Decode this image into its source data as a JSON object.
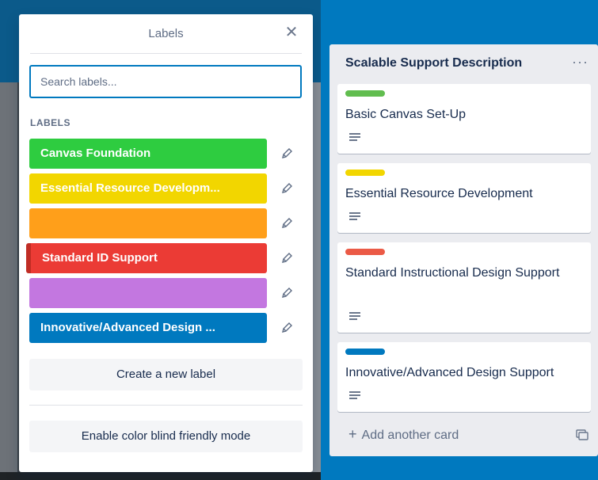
{
  "popover": {
    "title": "Labels",
    "close_icon": "close-icon",
    "search_placeholder": "Search labels...",
    "section_label": "LABELS",
    "labels": [
      {
        "name": "Canvas Foundation",
        "color": "#2ecc40"
      },
      {
        "name": "Essential Resource Developm...",
        "color": "#f2d600"
      },
      {
        "name": "",
        "color": "#ff9f1a"
      },
      {
        "name": "Standard ID Support",
        "color": "#eb3b35"
      },
      {
        "name": "",
        "color": "#c377e0"
      },
      {
        "name": "Innovative/Advanced Design ...",
        "color": "#0079bf"
      }
    ],
    "edit_icon": "pencil-icon",
    "create_label": "Create a new label",
    "colorblind_label": "Enable color blind friendly mode"
  },
  "list": {
    "title": "Scalable Support Description",
    "menu_icon": "more-icon",
    "cards": [
      {
        "title": "Basic Canvas Set-Up",
        "label_color": "#61bd4f"
      },
      {
        "title": "Essential Resource Development",
        "label_color": "#f2d600"
      },
      {
        "title": "Standard Instructional Design Support",
        "label_color": "#eb5a46"
      },
      {
        "title": "Innovative/Advanced Design Support",
        "label_color": "#0079bf"
      }
    ],
    "add_card": "Add another card",
    "template_icon": "card-template-icon"
  }
}
